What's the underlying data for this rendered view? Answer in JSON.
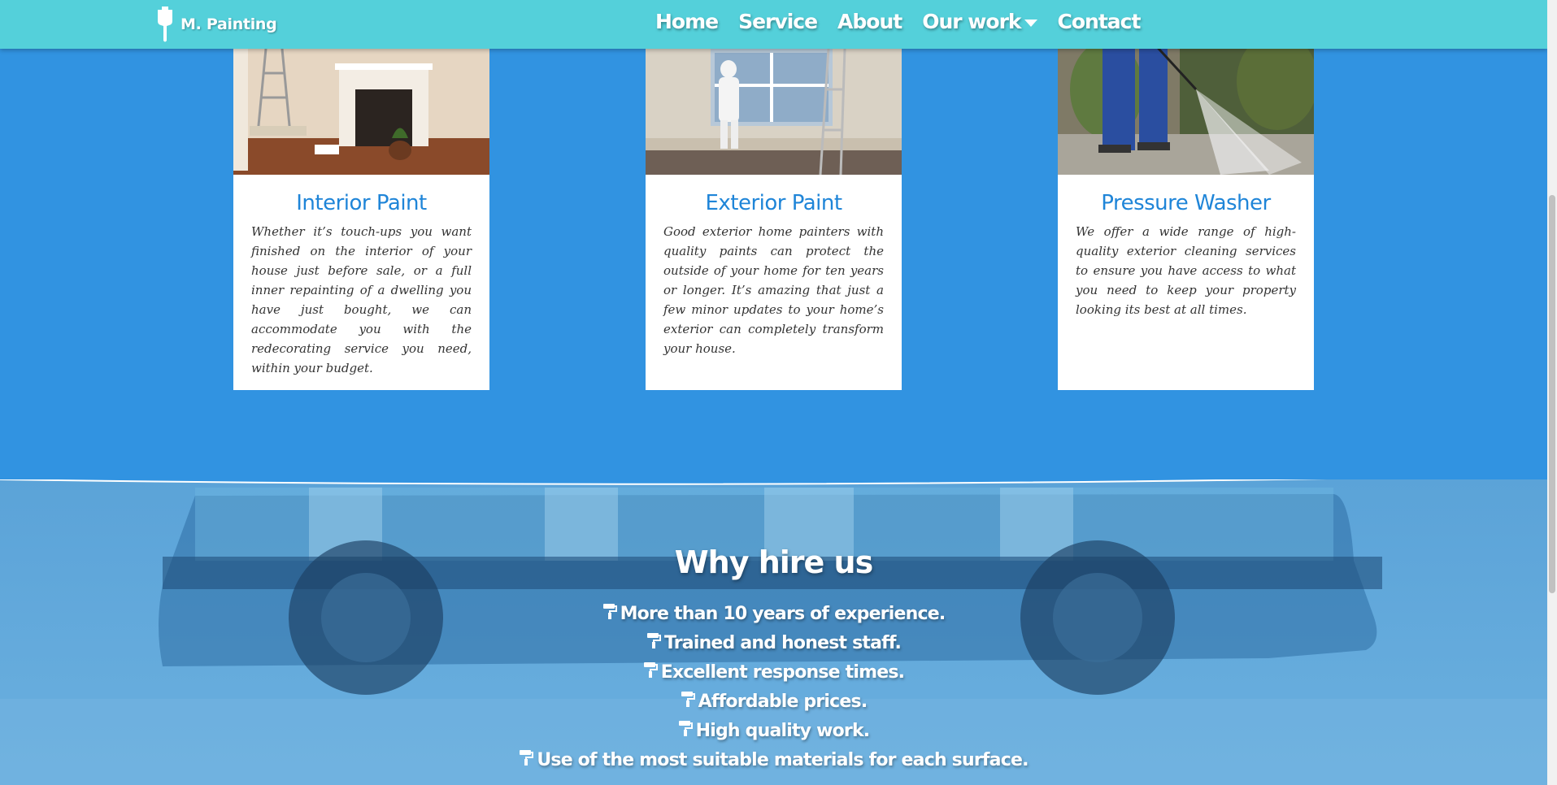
{
  "navbar": {
    "brand": "M. Painting",
    "brand_icon": "paint-brush-icon",
    "links": [
      {
        "label": "Home"
      },
      {
        "label": "Service"
      },
      {
        "label": "About"
      },
      {
        "label": "Our work",
        "has_dropdown": true
      },
      {
        "label": "Contact"
      }
    ],
    "background_color": "#54d0da"
  },
  "services": [
    {
      "title": "Interior Paint",
      "text": "Whether it’s touch-ups you want finished on the interior of your house just before sale, or a full inner repainting of a dwelling you have just bought, we can accommodate you with the redecorating service you need, within your budget."
    },
    {
      "title": "Exterior Paint",
      "text": "Good exterior home painters with quality paints can protect the outside of your home for ten years or longer. It’s amazing that just a few minor updates to your home’s exterior can completely transform your house."
    },
    {
      "title": "Pressure Washer",
      "text": "We offer a wide range of high-quality exterior cleaning services to ensure you have access to what you need to keep your property looking its best at all times."
    }
  ],
  "why": {
    "title": "Why hire us",
    "bullet_icon": "paint-roller-icon",
    "items": [
      "More than 10 years of experience.",
      "Trained and honest staff.",
      "Excellent response times.",
      "Affordable prices.",
      "High quality work.",
      "Use of the most suitable materials for each surface."
    ]
  },
  "colors": {
    "section_bg": "#3193e1",
    "card_title": "#1f85d8",
    "why_bg": "#5ba3d8"
  }
}
